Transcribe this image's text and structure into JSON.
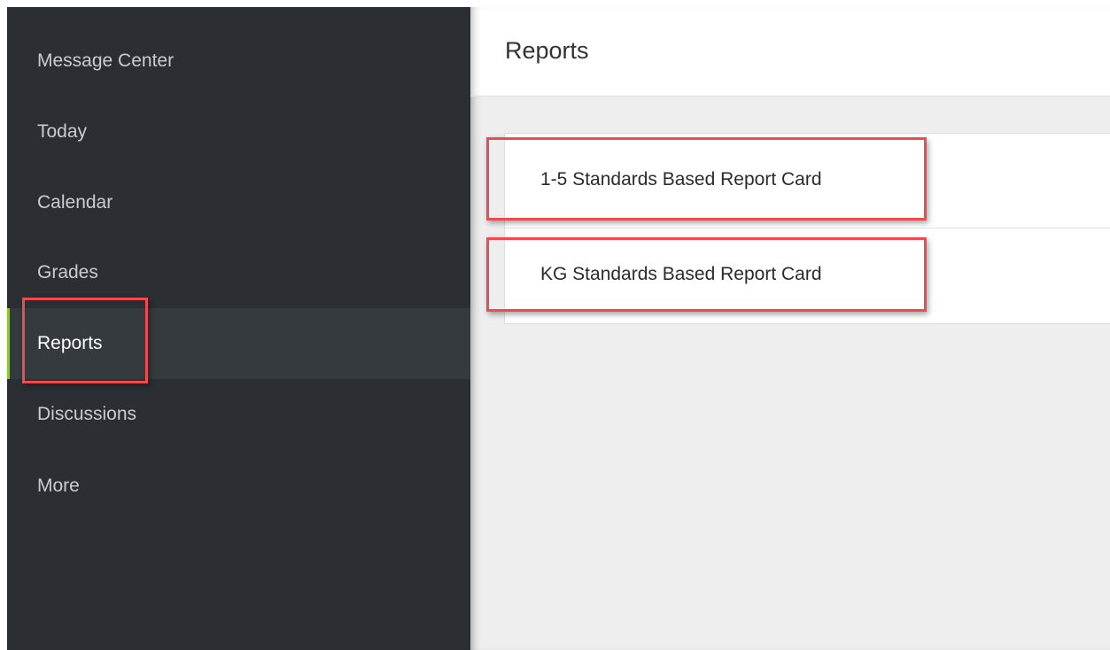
{
  "sidebar": {
    "items": [
      {
        "label": "Message Center",
        "active": false
      },
      {
        "label": "Today",
        "active": false
      },
      {
        "label": "Calendar",
        "active": false
      },
      {
        "label": "Grades",
        "active": false
      },
      {
        "label": "Reports",
        "active": true
      },
      {
        "label": "Discussions",
        "active": false
      },
      {
        "label": "More",
        "active": false
      }
    ]
  },
  "header": {
    "title": "Reports"
  },
  "reports": {
    "items": [
      {
        "label": "1-5 Standards Based Report Card"
      },
      {
        "label": "KG Standards Based Report Card"
      }
    ]
  },
  "theme": {
    "sidebar_bg": "#2b2f33",
    "active_indicator": "#8cc63f",
    "highlight": "#ef4a4f"
  }
}
